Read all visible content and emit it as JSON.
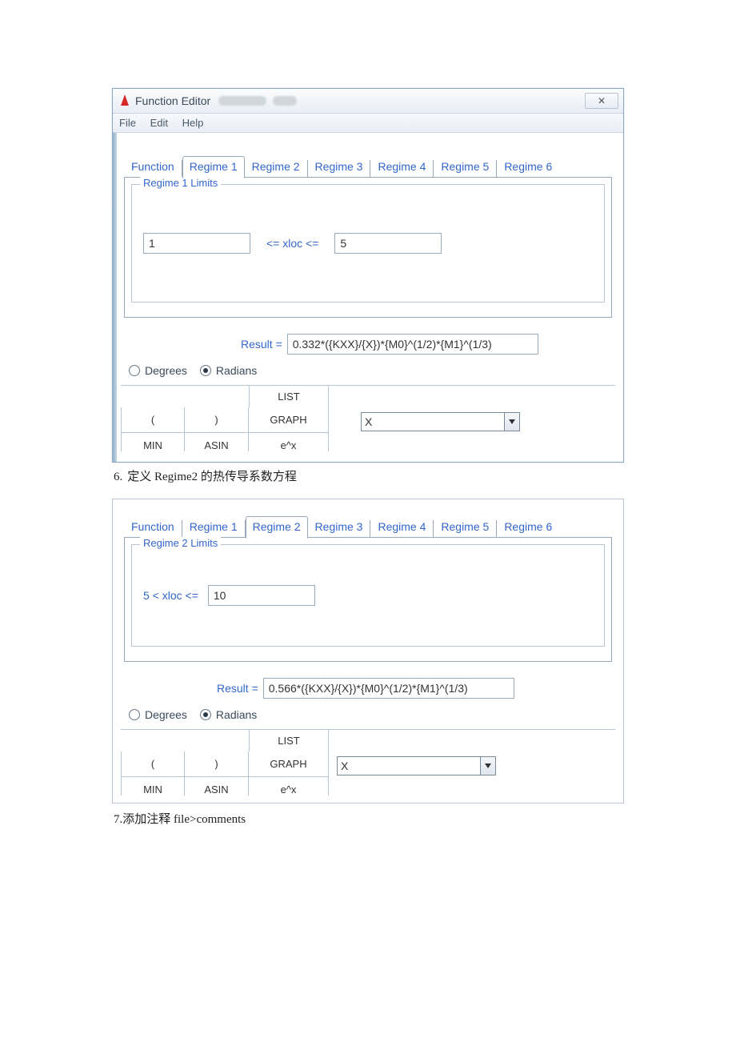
{
  "window": {
    "title": "Function Editor",
    "close_glyph": "✕",
    "menu": {
      "file": "File",
      "edit": "Edit",
      "help": "Help"
    }
  },
  "tabs": {
    "function": "Function",
    "r1": "Regime 1",
    "r2": "Regime 2",
    "r3": "Regime 3",
    "r4": "Regime 4",
    "r5": "Regime 5",
    "r6": "Regime 6"
  },
  "panel1": {
    "legend": "Regime 1 Limits",
    "lower": "1",
    "mid_label": "<=  xloc  <=",
    "upper": "5",
    "result_label": "Result  =",
    "result_value": "0.332*({KXX}/{X})*{M0}^(1/2)*{M1}^(1/3)"
  },
  "panel2": {
    "legend": "Regime 2 Limits",
    "lower_label": "5  <  xloc  <=",
    "upper": "10",
    "result_label": "Result  =",
    "result_value": "0.566*({KXX}/{X})*{M0}^(1/2)*{M1}^(1/3)"
  },
  "angles": {
    "degrees": "Degrees",
    "radians": "Radians"
  },
  "pad": {
    "list": "LIST",
    "lparen": "(",
    "rparen": ")",
    "graph": "GRAPH",
    "min": "MIN",
    "asin": "ASIN",
    "ex": "e^x"
  },
  "combo": {
    "value": "X"
  },
  "captions": {
    "c6_num": "6.",
    "c6_text": "定义 Regime2 的热传导系数方程",
    "c7": "7.添加注释  file>comments"
  }
}
